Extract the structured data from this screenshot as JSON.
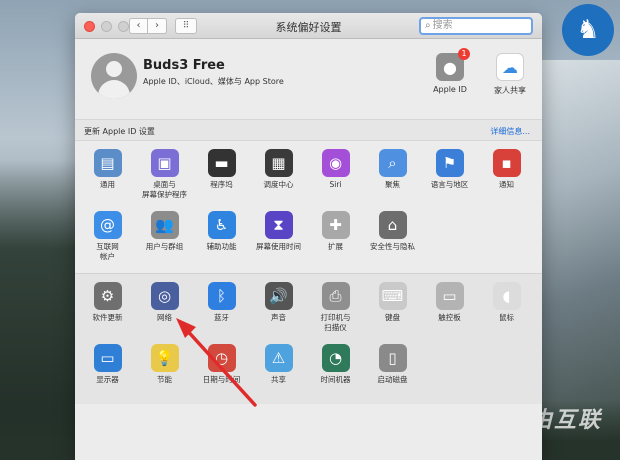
{
  "window": {
    "title": "系统偏好设置",
    "search_placeholder": "搜索",
    "back": "‹",
    "forward": "›",
    "grid": "⠿"
  },
  "account": {
    "name": "Buds3 Free",
    "subtitle": "Apple ID、iCloud、媒体与 App Store",
    "apple_id_label": "Apple ID",
    "apple_id_badge": "1",
    "family_label": "家人共享"
  },
  "notice": {
    "text": "更新 Apple ID 设置",
    "link": "详细信息..."
  },
  "row1": [
    {
      "label": "通用",
      "icon": "general-icon",
      "color": "#5b8ec9",
      "glyph": "▤"
    },
    {
      "label": "桌面与\n屏幕保护程序",
      "icon": "desktop-icon",
      "color": "#7b6fd6",
      "glyph": "▣"
    },
    {
      "label": "程序坞",
      "icon": "dock-icon",
      "color": "#333333",
      "glyph": "▬"
    },
    {
      "label": "调度中心",
      "icon": "mission-control-icon",
      "color": "#3a3a3a",
      "glyph": "▦"
    },
    {
      "label": "Siri",
      "icon": "siri-icon",
      "color": "#a44fd8",
      "glyph": "◉"
    },
    {
      "label": "聚焦",
      "icon": "spotlight-icon",
      "color": "#4f90e0",
      "glyph": "⌕"
    },
    {
      "label": "语言与地区",
      "icon": "language-icon",
      "color": "#3b7fd9",
      "glyph": "⚑"
    },
    {
      "label": "通知",
      "icon": "notifications-icon",
      "color": "#d8413a",
      "glyph": "▪"
    }
  ],
  "row2": [
    {
      "label": "互联网\n帐户",
      "icon": "internet-accounts-icon",
      "color": "#3c8ee6",
      "glyph": "@"
    },
    {
      "label": "用户与群组",
      "icon": "users-icon",
      "color": "#8c8c8c",
      "glyph": "👥"
    },
    {
      "label": "辅助功能",
      "icon": "accessibility-icon",
      "color": "#2f84df",
      "glyph": "♿"
    },
    {
      "label": "屏幕使用时间",
      "icon": "screen-time-icon",
      "color": "#5a44c6",
      "glyph": "⧗"
    },
    {
      "label": "扩展",
      "icon": "extensions-icon",
      "color": "#a8a8a8",
      "glyph": "✚"
    },
    {
      "label": "安全性与隐私",
      "icon": "security-icon",
      "color": "#6d6d6d",
      "glyph": "⌂"
    }
  ],
  "row3": [
    {
      "label": "软件更新",
      "icon": "software-update-icon",
      "color": "#6f6f6f",
      "glyph": "⚙"
    },
    {
      "label": "网络",
      "icon": "network-icon",
      "color": "#4a5f9e",
      "glyph": "◎"
    },
    {
      "label": "蓝牙",
      "icon": "bluetooth-icon",
      "color": "#2f7fe0",
      "glyph": "ᛒ"
    },
    {
      "label": "声音",
      "icon": "sound-icon",
      "color": "#555555",
      "glyph": "🔊"
    },
    {
      "label": "打印机与\n扫描仪",
      "icon": "printer-icon",
      "color": "#8f8f8f",
      "glyph": "⎙"
    },
    {
      "label": "键盘",
      "icon": "keyboard-icon",
      "color": "#c9c9c9",
      "glyph": "⌨"
    },
    {
      "label": "触控板",
      "icon": "trackpad-icon",
      "color": "#b3b3b3",
      "glyph": "▭"
    },
    {
      "label": "鼠标",
      "icon": "mouse-icon",
      "color": "#dcdcdc",
      "glyph": "◖"
    }
  ],
  "row4": [
    {
      "label": "显示器",
      "icon": "displays-icon",
      "color": "#2f7fd6",
      "glyph": "▭"
    },
    {
      "label": "节能",
      "icon": "energy-saver-icon",
      "color": "#e8c94a",
      "glyph": "💡"
    },
    {
      "label": "日期与时间",
      "icon": "date-time-icon",
      "color": "#d24a3d",
      "glyph": "◷"
    },
    {
      "label": "共享",
      "icon": "sharing-icon",
      "color": "#4ea2de",
      "glyph": "⚠"
    },
    {
      "label": "时间机器",
      "icon": "time-machine-icon",
      "color": "#2f7a5a",
      "glyph": "◔"
    },
    {
      "label": "启动磁盘",
      "icon": "startup-disk-icon",
      "color": "#8a8a8a",
      "glyph": "▯"
    }
  ],
  "desktop": {
    "watermark": "自由互联"
  }
}
